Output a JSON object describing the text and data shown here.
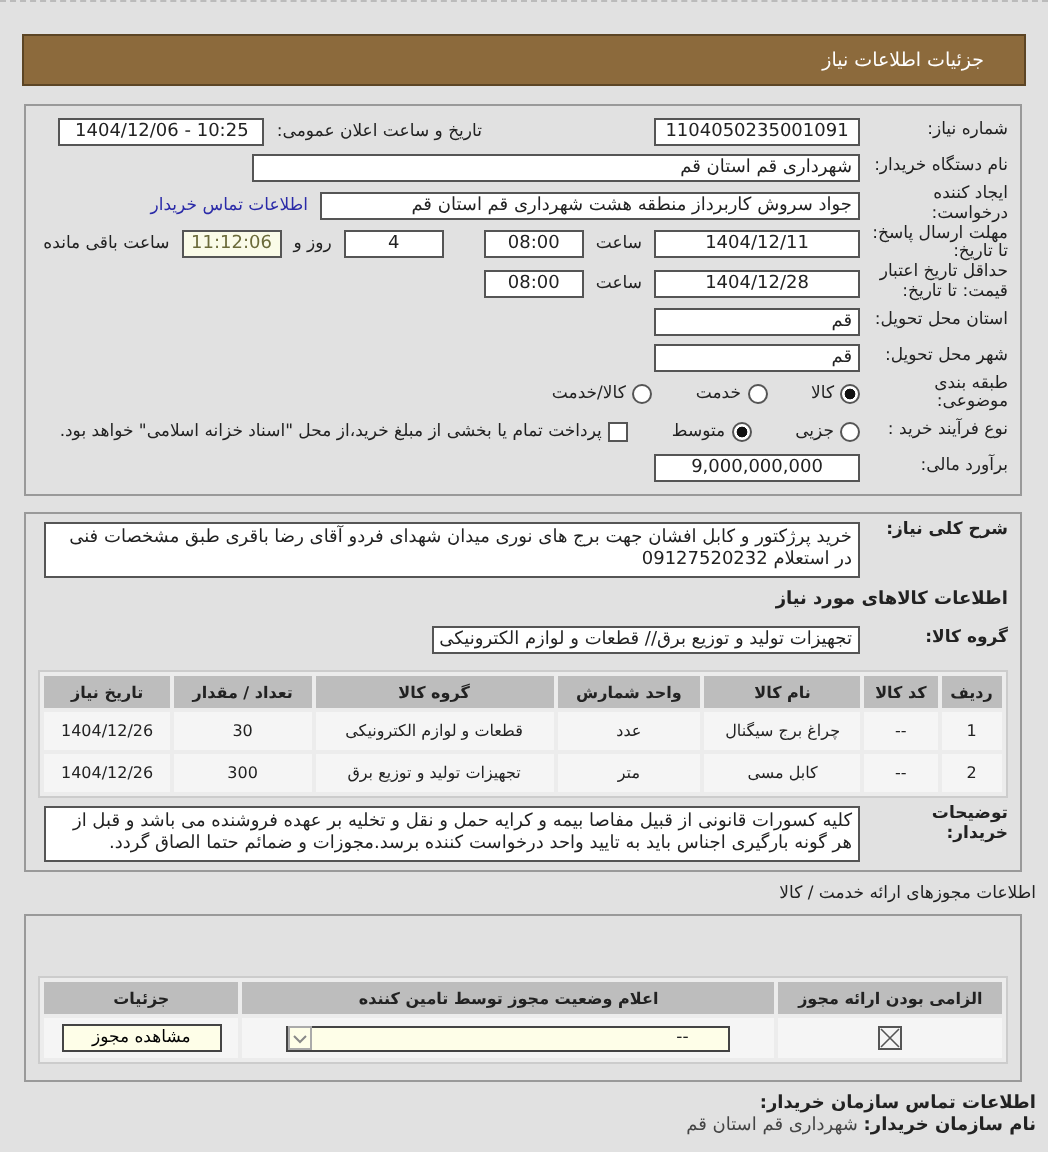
{
  "header": {
    "title": "جزئیات اطلاعات نیاز"
  },
  "need_number": {
    "label": "شماره نیاز:",
    "value": "1104050235001091"
  },
  "announce": {
    "label": "تاریخ و ساعت اعلان عمومی:",
    "value": "1404/12/06 - 10:25"
  },
  "buyer": {
    "label": "نام دستگاه خریدار:",
    "value": "شهرداری قم استان قم"
  },
  "creator": {
    "label": "ایجاد کننده درخواست:",
    "value": "جواد سروش کاربرداز منطقه هشت شهرداری قم استان قم",
    "link": "اطلاعات تماس خریدار"
  },
  "deadline": {
    "label": "مهلت ارسال پاسخ: تا تاریخ:",
    "date": "1404/12/11",
    "time_label": "ساعت",
    "time": "08:00",
    "days": "4",
    "days_label": "روز و",
    "remaining": "11:12:06",
    "remaining_label": "ساعت باقی مانده"
  },
  "validity": {
    "label": "حداقل تاریخ اعتبار قیمت: تا تاریخ:",
    "date": "1404/12/28",
    "time_label": "ساعت",
    "time": "08:00"
  },
  "province": {
    "label": "استان محل تحویل:",
    "value": "قم"
  },
  "city": {
    "label": "شهر محل تحویل:",
    "value": "قم"
  },
  "category": {
    "label": "طبقه بندی موضوعی:",
    "options": [
      {
        "label": "کالا",
        "selected": true
      },
      {
        "label": "خدمت",
        "selected": false
      },
      {
        "label": "کالا/خدمت",
        "selected": false
      }
    ]
  },
  "process": {
    "label": "نوع فرآیند خرید :",
    "options": [
      {
        "label": "جزیی",
        "selected": false
      },
      {
        "label": "متوسط",
        "selected": true
      }
    ],
    "treasury": {
      "label": "پرداخت تمام یا بخشی از مبلغ خرید،از محل \"اسناد خزانه اسلامی\" خواهد بود.",
      "checked": false
    }
  },
  "budget": {
    "label": "برآورد مالی:",
    "value": "9,000,000,000"
  },
  "description": {
    "label": "شرح کلی نیاز:",
    "value": "خرید پرژکتور و کابل افشان جهت برج های نوری میدان شهدای فردو آقای رضا باقری طبق مشخصات فنی در استعلام 09127520232"
  },
  "goods_title": "اطلاعات کالاهای مورد نیاز",
  "goods_group": {
    "label": "گروه کالا:",
    "value": "تجهیزات تولید و توزیع برق// قطعات و لوازم الکترونیکی"
  },
  "goods_table": {
    "columns": [
      "ردیف",
      "کد کالا",
      "نام کالا",
      "واحد شمارش",
      "گروه کالا",
      "تعداد / مقدار",
      "تاریخ نیاز"
    ],
    "rows": [
      [
        "1",
        "--",
        "چراغ برج سیگنال",
        "عدد",
        "قطعات و لوازم الکترونیکی",
        "30",
        "1404/12/26"
      ],
      [
        "2",
        "--",
        "کابل مسی",
        "متر",
        "تجهیزات تولید و توزیع برق",
        "300",
        "1404/12/26"
      ]
    ]
  },
  "notes": {
    "label": "توضیحات خریدار:",
    "value": "کلیه کسورات قانونی از قبیل مفاصا بیمه و کرایه حمل و نقل و تخلیه بر عهده فروشنده می باشد و قبل از هر گونه بارگیری اجناس باید به تایید واحد درخواست کننده برسد.مجوزات و ضمائم حتما الصاق گردد."
  },
  "permits": {
    "title": "اطلاعات مجوزهای ارائه خدمت / کالا",
    "columns": [
      "الزامی بودن ارائه مجوز",
      "اعلام وضعیت مجوز توسط تامین کننده",
      "جزئیات"
    ],
    "rows": [
      {
        "required": true,
        "status": "--",
        "button": "مشاهده مجوز"
      }
    ]
  },
  "contact": {
    "title": "اطلاعات تماس سازمان خریدار:",
    "org_label": "نام سازمان خریدار:",
    "org": "شهرداری قم استان قم"
  }
}
